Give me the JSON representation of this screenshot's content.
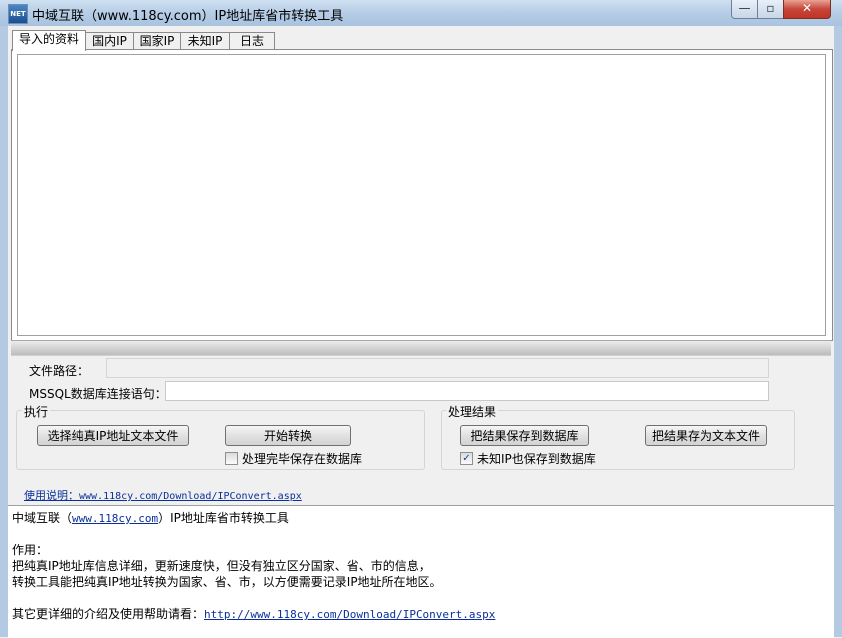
{
  "window": {
    "title": "中域互联（www.118cy.com）IP地址库省市转换工具",
    "icon_text": "NET",
    "minimize_glyph": "—",
    "maximize_glyph": "▫",
    "close_glyph": "✕"
  },
  "tabs": [
    {
      "label": "导入的资料",
      "active": true
    },
    {
      "label": "国内IP",
      "active": false
    },
    {
      "label": "国家IP",
      "active": false
    },
    {
      "label": "未知IP",
      "active": false
    },
    {
      "label": "日志",
      "active": false
    }
  ],
  "form": {
    "file_path_label": "文件路径：",
    "file_path_value": "",
    "mssql_label": "MSSQL数据库连接语句：",
    "mssql_value": ""
  },
  "execute_group": {
    "title": "执行",
    "select_file_button": "选择纯真IP地址文本文件",
    "start_button": "开始转换",
    "save_after_checkbox": {
      "label": "处理完毕保存在数据库",
      "checked": false
    }
  },
  "result_group": {
    "title": "处理结果",
    "save_db_button": "把结果保存到数据库",
    "save_text_button": "把结果存为文本文件",
    "unknown_ip_checkbox": {
      "label": "未知IP也保存到数据库",
      "checked": true,
      "check_glyph": "✓"
    }
  },
  "help": {
    "label": "使用说明：",
    "url": "www.118cy.com/Download/IPConvert.aspx"
  },
  "info": {
    "line1_prefix": "中域互联（",
    "line1_link": "www.118cy.com",
    "line1_suffix": "）IP地址库省市转换工具",
    "line2": "作用：",
    "line3": "把纯真IP地址库信息详细，更新速度快，但没有独立区分国家、省、市的信息，",
    "line4": "转换工具能把纯真IP地址转换为国家、省、市，以方便需要记录IP地址所在地区。",
    "line5_prefix": "其它更详细的介绍及使用帮助请看：",
    "line5_link": "http://www.118cy.com/Download/IPConvert.aspx"
  }
}
